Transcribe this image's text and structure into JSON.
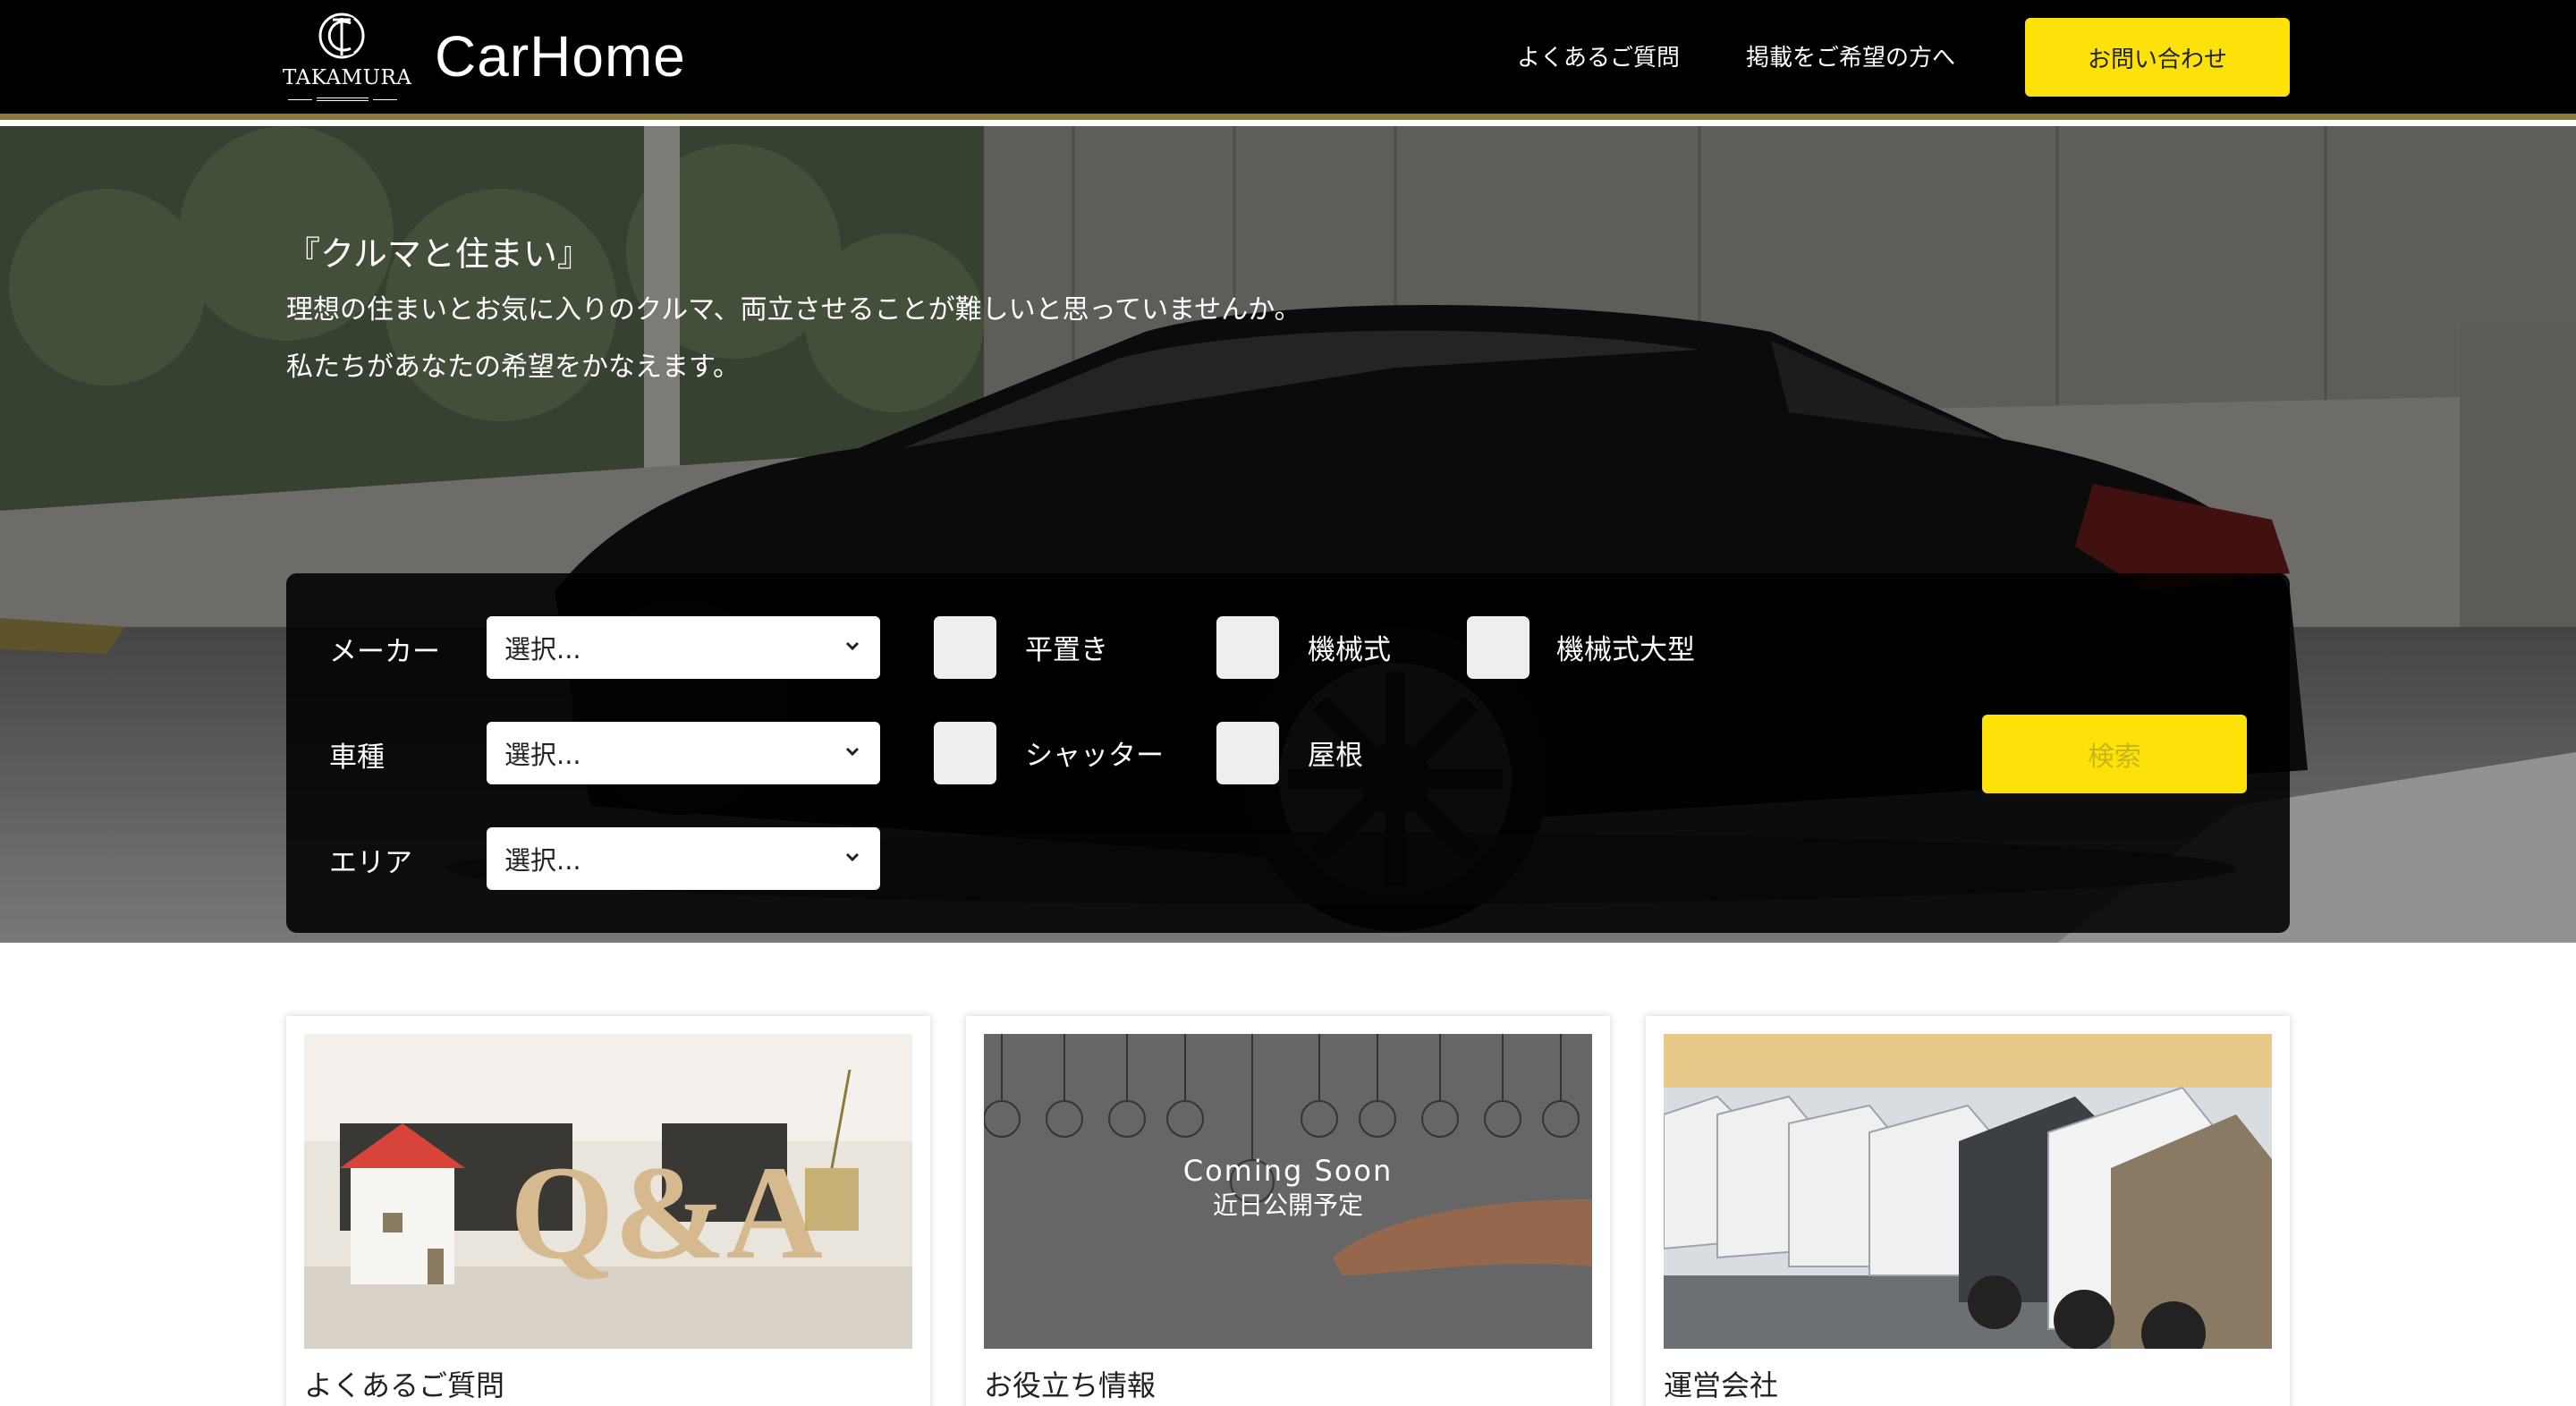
{
  "header": {
    "logo_word": "TAKAMURA",
    "brand": "CarHome",
    "nav_faq": "よくあるご質問",
    "nav_post": "掲載をご希望の方へ",
    "contact": "お問い合わせ"
  },
  "hero": {
    "title": "『クルマと住まい』",
    "line1": "理想の住まいとお気に入りのクルマ、両立させることが難しいと思っていませんか。",
    "line2": "私たちがあなたの希望をかなえます。"
  },
  "search": {
    "maker_label": "メーカー",
    "type_label": "車種",
    "area_label": "エリア",
    "maker_value": "選択...",
    "type_value": "選択...",
    "area_value": "選択...",
    "checks": [
      "平置き",
      "機械式",
      "機械式大型",
      "シャッター",
      "屋根"
    ],
    "button": "検索"
  },
  "cards": [
    {
      "title": "よくあるご質問",
      "image_text": "Q&A"
    },
    {
      "title": "お役立ち情報",
      "overlay_en": "Coming Soon",
      "overlay_jp": "近日公開予定"
    },
    {
      "title": "運営会社"
    }
  ],
  "colors": {
    "accent": "#fde20a",
    "header_bg": "#000000",
    "header_rule": "#8c7a3a"
  }
}
